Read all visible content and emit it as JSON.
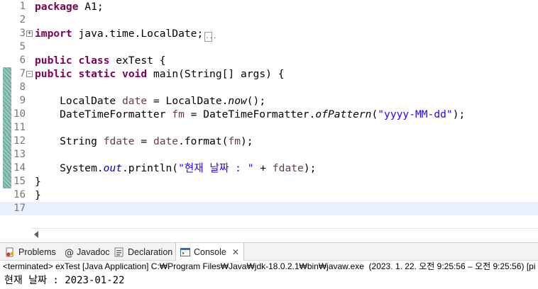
{
  "editor": {
    "lines": [
      {
        "num": "1",
        "segments": [
          {
            "t": "package",
            "c": "kw"
          },
          {
            "t": " A1;",
            "c": ""
          }
        ]
      },
      {
        "num": "2",
        "segments": []
      },
      {
        "num": "3",
        "fold": "+",
        "segments": [
          {
            "t": "import",
            "c": "kw"
          },
          {
            "t": " java.time.LocalDate;",
            "c": ""
          }
        ],
        "collapsed": "..."
      },
      {
        "num": "5",
        "segments": []
      },
      {
        "num": "6",
        "segments": [
          {
            "t": "public",
            "c": "kw"
          },
          {
            "t": " ",
            "c": ""
          },
          {
            "t": "class",
            "c": "kw"
          },
          {
            "t": " exTest {",
            "c": ""
          }
        ]
      },
      {
        "num": "7",
        "fold": "-",
        "changed": true,
        "segments": [
          {
            "t": "public",
            "c": "kw"
          },
          {
            "t": " ",
            "c": ""
          },
          {
            "t": "static",
            "c": "kw"
          },
          {
            "t": " ",
            "c": ""
          },
          {
            "t": "void",
            "c": "kw"
          },
          {
            "t": " main(String[] args) {",
            "c": ""
          }
        ]
      },
      {
        "num": "8",
        "changed": true,
        "segments": []
      },
      {
        "num": "9",
        "changed": true,
        "segments": [
          {
            "t": "    LocalDate ",
            "c": ""
          },
          {
            "t": "date",
            "c": "var"
          },
          {
            "t": " = LocalDate.",
            "c": ""
          },
          {
            "t": "now",
            "c": "st-it"
          },
          {
            "t": "();",
            "c": ""
          }
        ]
      },
      {
        "num": "10",
        "changed": true,
        "segments": [
          {
            "t": "    DateTimeFormatter ",
            "c": ""
          },
          {
            "t": "fm",
            "c": "var"
          },
          {
            "t": " = DateTimeFormatter.",
            "c": ""
          },
          {
            "t": "ofPattern",
            "c": "st-it"
          },
          {
            "t": "(",
            "c": ""
          },
          {
            "t": "\"yyyy-MM-dd\"",
            "c": "str"
          },
          {
            "t": ");",
            "c": ""
          }
        ]
      },
      {
        "num": "11",
        "changed": true,
        "segments": []
      },
      {
        "num": "12",
        "changed": true,
        "segments": [
          {
            "t": "    String ",
            "c": ""
          },
          {
            "t": "fdate",
            "c": "var"
          },
          {
            "t": " = ",
            "c": ""
          },
          {
            "t": "date",
            "c": "var"
          },
          {
            "t": ".format(",
            "c": ""
          },
          {
            "t": "fm",
            "c": "var"
          },
          {
            "t": ");",
            "c": ""
          }
        ]
      },
      {
        "num": "13",
        "changed": true,
        "segments": []
      },
      {
        "num": "14",
        "changed": true,
        "segments": [
          {
            "t": "    System.",
            "c": ""
          },
          {
            "t": "out",
            "c": "field"
          },
          {
            "t": ".println(",
            "c": ""
          },
          {
            "t": "\"현재 날짜 : \"",
            "c": "str"
          },
          {
            "t": " + ",
            "c": ""
          },
          {
            "t": "fdate",
            "c": "var"
          },
          {
            "t": ");",
            "c": ""
          }
        ]
      },
      {
        "num": "15",
        "changed": true,
        "segments": [
          {
            "t": "}",
            "c": ""
          }
        ]
      },
      {
        "num": "16",
        "segments": [
          {
            "t": "}",
            "c": ""
          }
        ]
      },
      {
        "num": "17",
        "current": true,
        "segments": []
      }
    ]
  },
  "console": {
    "tabs": [
      {
        "label": "Problems",
        "icon": "problems-icon"
      },
      {
        "label": "Javadoc",
        "icon": "javadoc-icon"
      },
      {
        "label": "Declaration",
        "icon": "declaration-icon"
      },
      {
        "label": "Console",
        "icon": "console-icon",
        "active": true
      }
    ],
    "close_glyph": "✕",
    "status": "<terminated> exTest [Java Application] C:₩Program Files₩Java₩jdk-18.0.2.1₩bin₩javaw.exe  (2023. 1. 22. 오전 9:25:56 – 오전 9:25:56) [pi",
    "output": "현재 날짜 : 2023-01-22"
  }
}
